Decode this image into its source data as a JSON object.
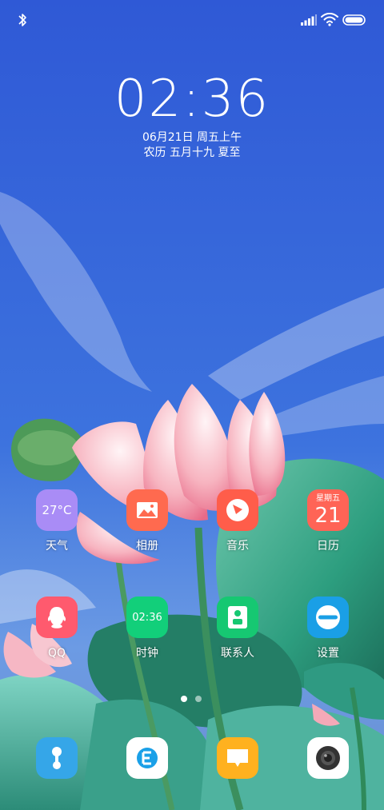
{
  "status_bar": {
    "bluetooth_icon": "bluetooth-icon",
    "signal_icon": "signal-icon",
    "wifi_icon": "wifi-icon",
    "battery_icon": "battery-icon"
  },
  "lock": {
    "time": "02:36",
    "date": "06月21日 周五上午",
    "lunar": "农历 五月十九 夏至"
  },
  "apps_row1": [
    {
      "label": "天气",
      "icon_text": "27°C",
      "icon": "weather-icon",
      "color": "#a98cf6"
    },
    {
      "label": "相册",
      "icon": "gallery-icon",
      "color": "#ff6a4f"
    },
    {
      "label": "音乐",
      "icon": "music-icon",
      "color": "#ff5d4a"
    },
    {
      "label": "日历",
      "icon_small": "星期五",
      "icon_big": "21",
      "icon": "calendar-icon",
      "color": "#ff6456"
    }
  ],
  "apps_row2": [
    {
      "label": "QQ",
      "icon": "qq-icon",
      "color": "#ff5a6e"
    },
    {
      "label": "时钟",
      "icon_text": "02:36",
      "icon": "clock-icon",
      "color": "#12cf7a"
    },
    {
      "label": "联系人",
      "icon": "contacts-icon",
      "color": "#16c872"
    },
    {
      "label": "设置",
      "icon": "settings-icon",
      "color": "#1a9fe6"
    }
  ],
  "dock": [
    {
      "icon": "phone-icon",
      "color": "#35a6e8"
    },
    {
      "icon": "browser-icon",
      "color": "#ffffff"
    },
    {
      "icon": "messages-icon",
      "color": "#ffb11f"
    },
    {
      "icon": "camera-icon",
      "color": "#ffffff"
    }
  ],
  "pager": {
    "current": 1,
    "total": 2
  }
}
